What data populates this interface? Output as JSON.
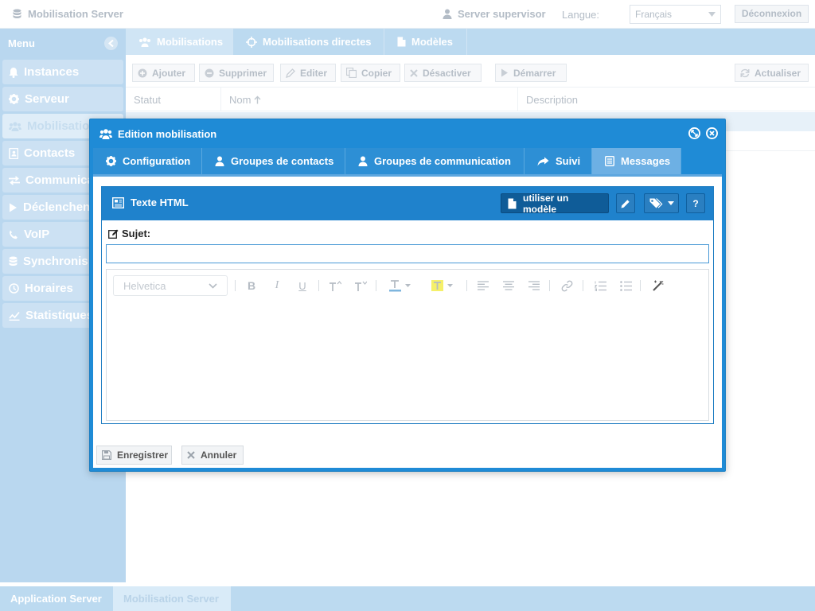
{
  "app": {
    "title": "Mobilisation Server",
    "user": "Server supervisor",
    "language_label": "Langue:",
    "language_value": "Français",
    "logout_label": "Déconnexion"
  },
  "sidebar": {
    "title": "Menu",
    "items": [
      {
        "label": "Instances",
        "icon": "bell-icon"
      },
      {
        "label": "Serveur",
        "icon": "gear-icon"
      },
      {
        "label": "Mobilisation",
        "icon": "users-icon"
      },
      {
        "label": "Contacts",
        "icon": "address-book-icon"
      },
      {
        "label": "Communica",
        "icon": "exchange-icon"
      },
      {
        "label": "Déclenchen",
        "icon": "play-icon"
      },
      {
        "label": "VoIP",
        "icon": "phone-icon"
      },
      {
        "label": "Synchronis",
        "icon": "database-icon"
      },
      {
        "label": "Horaires",
        "icon": "clock-icon"
      },
      {
        "label": "Statistiques",
        "icon": "chart-icon"
      }
    ]
  },
  "main_tabs": [
    {
      "label": "Mobilisations",
      "icon": "users-icon"
    },
    {
      "label": "Mobilisations directes",
      "icon": "crosshairs-icon"
    },
    {
      "label": "Modèles",
      "icon": "file-icon"
    }
  ],
  "toolbar": {
    "add": "Ajouter",
    "delete": "Supprimer",
    "edit": "Editer",
    "copy": "Copier",
    "deactivate": "Désactiver",
    "start": "Démarrer",
    "refresh": "Actualiser"
  },
  "grid": {
    "columns": [
      "Statut",
      "Nom",
      "Description"
    ]
  },
  "bottom_tabs": [
    "Application Server",
    "Mobilisation Server"
  ],
  "dialog": {
    "title": "Edition mobilisation",
    "tabs": [
      {
        "label": "Configuration",
        "icon": "gear-icon"
      },
      {
        "label": "Groupes de contacts",
        "icon": "user-icon"
      },
      {
        "label": "Groupes de communication",
        "icon": "user-icon"
      },
      {
        "label": "Suivi",
        "icon": "share-icon"
      },
      {
        "label": "Messages",
        "icon": "book-icon"
      }
    ],
    "message_panel": {
      "title": "Texte HTML",
      "use_template_label": "utiliser un modèle",
      "help_label": "?"
    },
    "subject_label": "Sujet:",
    "subject_value": "",
    "editor": {
      "font": "Helvetica"
    },
    "save_label": "Enregistrer",
    "cancel_label": "Annuler"
  },
  "colors": {
    "dialog_blue": "#1f8bd6",
    "panel_header": "#1f82cc",
    "sidebar_bg": "#b9d7ef",
    "highlight_yellow": "#f5f06a"
  }
}
